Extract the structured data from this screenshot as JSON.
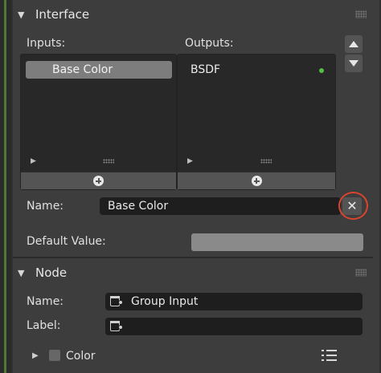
{
  "interface": {
    "title": "Interface",
    "inputs_label": "Inputs:",
    "outputs_label": "Outputs:",
    "inputs": [
      "Base Color"
    ],
    "outputs": [
      "BSDF"
    ],
    "name_label": "Name:",
    "name_value": "Base Color",
    "default_value_label": "Default Value:",
    "clear_icon": "x"
  },
  "node": {
    "title": "Node",
    "name_label": "Name:",
    "name_value": "Group Input",
    "label_label": "Label:",
    "label_value": "",
    "color_label": "Color"
  },
  "colors": {
    "panel_bg": "#3d3d3d",
    "field_bg": "#1e1e1e",
    "selected_item": "#7d7d7d",
    "socket_dot": "#50c040",
    "highlight_ring": "#d9452f",
    "default_value_swatch": "#8a8a8a"
  }
}
